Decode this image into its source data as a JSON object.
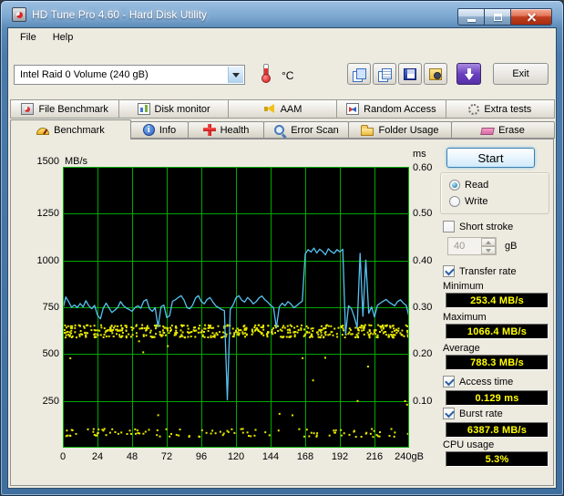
{
  "colors": {
    "value_text": "#ffff00",
    "chart_blue": "#56c2f1",
    "chart_yellow": "#e8e800",
    "grid_green": "#00a800",
    "chart_bg": "#000000"
  },
  "window": {
    "title": "HD Tune Pro 4.60 - Hard Disk Utility"
  },
  "menu": {
    "items": [
      "File",
      "Help"
    ]
  },
  "toolbar": {
    "drive_selected": "Intel Raid 0 Volume (240 gB)",
    "temp_unit": "°C",
    "exit_label": "Exit"
  },
  "tabs_top": [
    {
      "label": "File Benchmark",
      "icon": "file-benchmark-icon"
    },
    {
      "label": "Disk monitor",
      "icon": "disk-monitor-icon"
    },
    {
      "label": "AAM",
      "icon": "aam-icon"
    },
    {
      "label": "Random Access",
      "icon": "random-access-icon"
    },
    {
      "label": "Extra tests",
      "icon": "extra-tests-icon"
    }
  ],
  "tabs_main": [
    {
      "label": "Benchmark",
      "icon": "benchmark-icon",
      "active": true
    },
    {
      "label": "Info",
      "icon": "info-icon",
      "active": false
    },
    {
      "label": "Health",
      "icon": "health-icon",
      "active": false
    },
    {
      "label": "Error Scan",
      "icon": "error-scan-icon",
      "active": false
    },
    {
      "label": "Folder Usage",
      "icon": "folder-usage-icon",
      "active": false
    },
    {
      "label": "Erase",
      "icon": "erase-icon",
      "active": false
    }
  ],
  "chart_data": {
    "type": "line",
    "left_axis_unit": "MB/s",
    "right_axis_unit": "ms",
    "left_ticks": [
      "1500",
      "1250",
      "1000",
      "750",
      "500",
      "250"
    ],
    "right_ticks": [
      "0.60",
      "0.50",
      "0.40",
      "0.30",
      "0.20",
      "0.10"
    ],
    "x_ticks": [
      "0",
      "24",
      "48",
      "72",
      "96",
      "120",
      "144",
      "168",
      "192",
      "216",
      "240gB"
    ],
    "x_range": [
      0,
      240
    ],
    "y_range": [
      0,
      1500
    ],
    "grid_on": true,
    "bg_color": "#000000",
    "grid_color": "#00a800",
    "transfer_series": {
      "name": "Transfer rate",
      "color": "#56c2f1",
      "x_start": 0,
      "x_step": 2,
      "values": [
        740,
        805,
        780,
        750,
        762,
        748,
        770,
        752,
        785,
        758,
        742,
        760,
        708,
        688,
        745,
        772,
        746,
        722,
        735,
        748,
        780,
        758,
        746,
        738,
        728,
        748,
        758,
        745,
        782,
        792,
        742,
        728,
        748,
        645,
        752,
        762,
        695,
        705,
        782,
        790,
        802,
        812,
        788,
        748,
        742,
        762,
        800,
        812,
        780,
        768,
        792,
        802,
        778,
        758,
        748,
        738,
        732,
        255,
        738,
        762,
        800,
        812,
        788,
        778,
        802,
        788,
        768,
        780,
        800,
        810,
        790,
        778,
        760,
        748,
        642,
        752,
        772,
        758,
        780,
        768,
        748,
        758,
        772,
        782,
        1035,
        1058,
        1045,
        1066,
        1040,
        1060,
        1048,
        1030,
        1062,
        1048,
        1038,
        1058,
        1046,
        1060,
        605,
        758,
        742,
        698,
        642,
        1038,
        702,
        1002,
        718,
        752,
        698,
        760,
        772,
        782,
        792,
        778,
        768,
        758,
        780,
        790,
        772,
        760,
        698
      ]
    },
    "access_scatter": {
      "name": "Access time",
      "color": "#e8e800",
      "bands": [
        {
          "count": 540,
          "x_range": [
            0,
            240
          ],
          "levels": [
            597,
            609,
            620,
            632,
            644,
            656
          ],
          "jitter": 4,
          "seed": 11
        },
        {
          "count": 110,
          "x_range": [
            0,
            240
          ],
          "levels": [
            68,
            84,
            100
          ],
          "jitter": 6,
          "seed": 23
        },
        {
          "count": 14,
          "x_range": [
            0,
            240
          ],
          "levels": [
            180,
            260,
            340,
            420,
            500,
            560
          ],
          "jitter": 30,
          "seed": 5
        }
      ]
    }
  },
  "panel": {
    "start_label": "Start",
    "mode": {
      "read_label": "Read",
      "write_label": "Write",
      "read_checked": true,
      "write_checked": false
    },
    "short_stroke": {
      "label": "Short stroke",
      "checked": false,
      "value": "40",
      "unit": "gB"
    },
    "transfer_rate": {
      "label": "Transfer rate",
      "checked": true
    },
    "stats": [
      {
        "label": "Minimum",
        "value": "253.4 MB/s"
      },
      {
        "label": "Maximum",
        "value": "1066.4 MB/s"
      },
      {
        "label": "Average",
        "value": "788.3 MB/s"
      }
    ],
    "access_time": {
      "label": "Access time",
      "checked": true,
      "value": "0.129 ms"
    },
    "burst_rate": {
      "label": "Burst rate",
      "checked": true,
      "value": "6387.8 MB/s"
    },
    "cpu_usage": {
      "label": "CPU usage",
      "value": "5.3%"
    }
  }
}
